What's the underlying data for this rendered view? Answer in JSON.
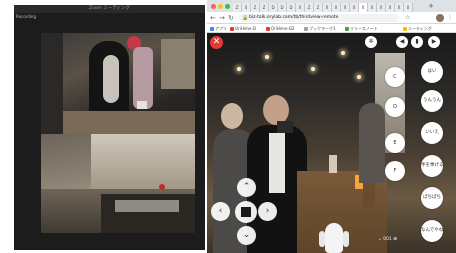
{
  "zoom": {
    "window_title": "Zoom ミーティング",
    "recording_label": "Recording"
  },
  "browser": {
    "tab_glyphs": [
      "Z",
      "S",
      "Z",
      "Z",
      "D",
      "D",
      "D",
      "X",
      "Z",
      "Z",
      "X",
      "X",
      "X",
      "X",
      "X",
      "X",
      "X",
      "X",
      "X",
      "X"
    ],
    "new_tab": "+",
    "nav": {
      "back": "←",
      "forward": "→",
      "reload": "↻",
      "lock": "🔒"
    },
    "url": "biz-talk.orylab.com/tb/thirdview-remote",
    "toolbar_icons": [
      "☆",
      "⋮"
    ],
    "bookmarks": [
      {
        "label": "アプリ",
        "color": "#4285f4"
      },
      {
        "label": "OriHime-D",
        "color": "#e53935"
      },
      {
        "label": "OriHime-D2",
        "color": "#e53935"
      },
      {
        "label": "ブックマーク1",
        "color": "#9e9e9e"
      },
      {
        "label": "リリースノート",
        "color": "#43a047"
      },
      {
        "label": "ミーティング",
        "color": "#fbbc04"
      }
    ]
  },
  "telepresence": {
    "close_label": "✕",
    "top_icons": [
      {
        "name": "settings-icon",
        "glyph": "✲"
      },
      {
        "name": "speaker-icon",
        "glyph": "◀"
      },
      {
        "name": "mic-icon",
        "glyph": "▮"
      },
      {
        "name": "video-icon",
        "glyph": "▶"
      }
    ],
    "side_buttons_left": [
      "C",
      "D",
      "E",
      "F"
    ],
    "side_buttons_right": [
      "はい",
      "うんうん",
      "いいえ",
      "手を挙げる",
      "ぱちぱち",
      "なんでやねん"
    ],
    "dpad": {
      "up": "⌃",
      "left": "‹",
      "right": "›",
      "down": "⌄",
      "center": "■"
    },
    "footer": "⌄ 001 ⊞"
  },
  "colors": {
    "close_button": "#e53935",
    "button_fill": "#ffffff",
    "tabstrip": "#dee1e6"
  }
}
